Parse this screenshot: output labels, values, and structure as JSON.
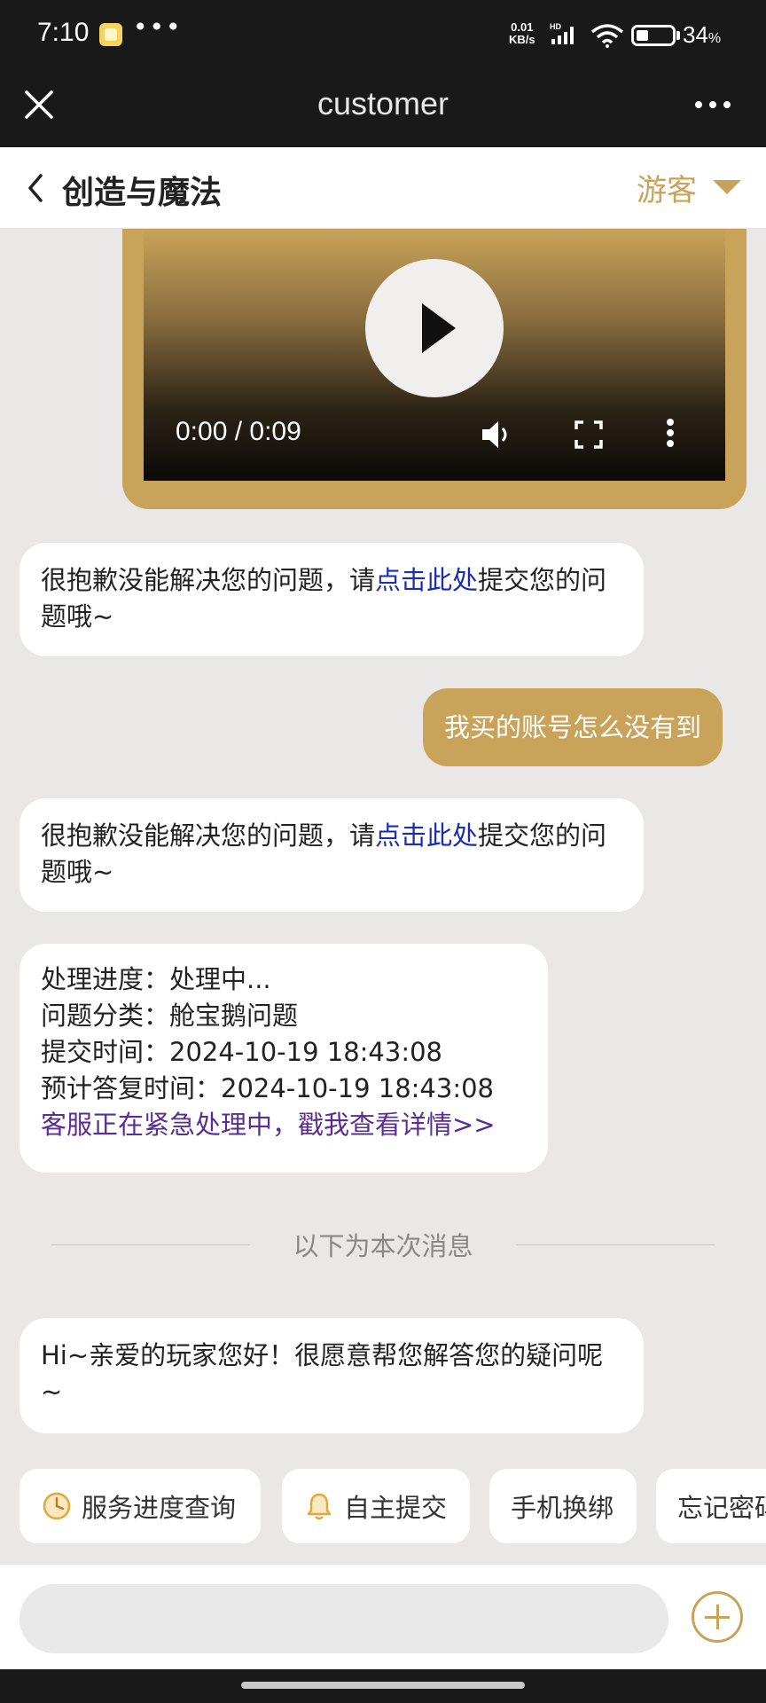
{
  "status_bar": {
    "time": "7:10",
    "speed_value": "0.01",
    "speed_unit": "KB/s",
    "network": "HD",
    "battery_percent": "34",
    "battery_unit": "%",
    "battery_level": 0.34
  },
  "app_bar": {
    "title": "customer"
  },
  "header": {
    "title": "创造与魔法",
    "user_label": "游客"
  },
  "video": {
    "time": "0:00 / 0:09"
  },
  "messages": {
    "bot1": {
      "prefix": "很抱歉没能解决您的问题，请",
      "link": "点击此处",
      "suffix": "提交您的问题哦~"
    },
    "user1": "我买的账号怎么没有到",
    "bot2": {
      "prefix": "很抱歉没能解决您的问题，请",
      "link": "点击此处",
      "suffix": "提交您的问题哦~"
    },
    "status": {
      "progress": "处理进度：处理中...",
      "category": "问题分类：舱宝鹅问题",
      "submit_time": "提交时间：2024-10-19 18:43:08",
      "expected_time": "预计答复时间：2024-10-19 18:43:08",
      "details_link": "客服正在紧急处理中，戳我查看详情>>"
    },
    "divider": "以下为本次消息",
    "greeting": "Hi~亲爱的玩家您好！很愿意帮您解答您的疑问呢~"
  },
  "quick_actions": [
    {
      "label": "服务进度查询",
      "icon": "clock-icon"
    },
    {
      "label": "自主提交",
      "icon": "bell-icon"
    },
    {
      "label": "手机换绑",
      "icon": ""
    },
    {
      "label": "忘记密码",
      "icon": ""
    }
  ],
  "input": {
    "placeholder": ""
  },
  "colors": {
    "accent": "#c9a35a",
    "link_blue": "#1a2db0",
    "link_purple": "#5a2d92",
    "dark_bar": "#191919",
    "chat_bg": "#e9e8e7"
  }
}
